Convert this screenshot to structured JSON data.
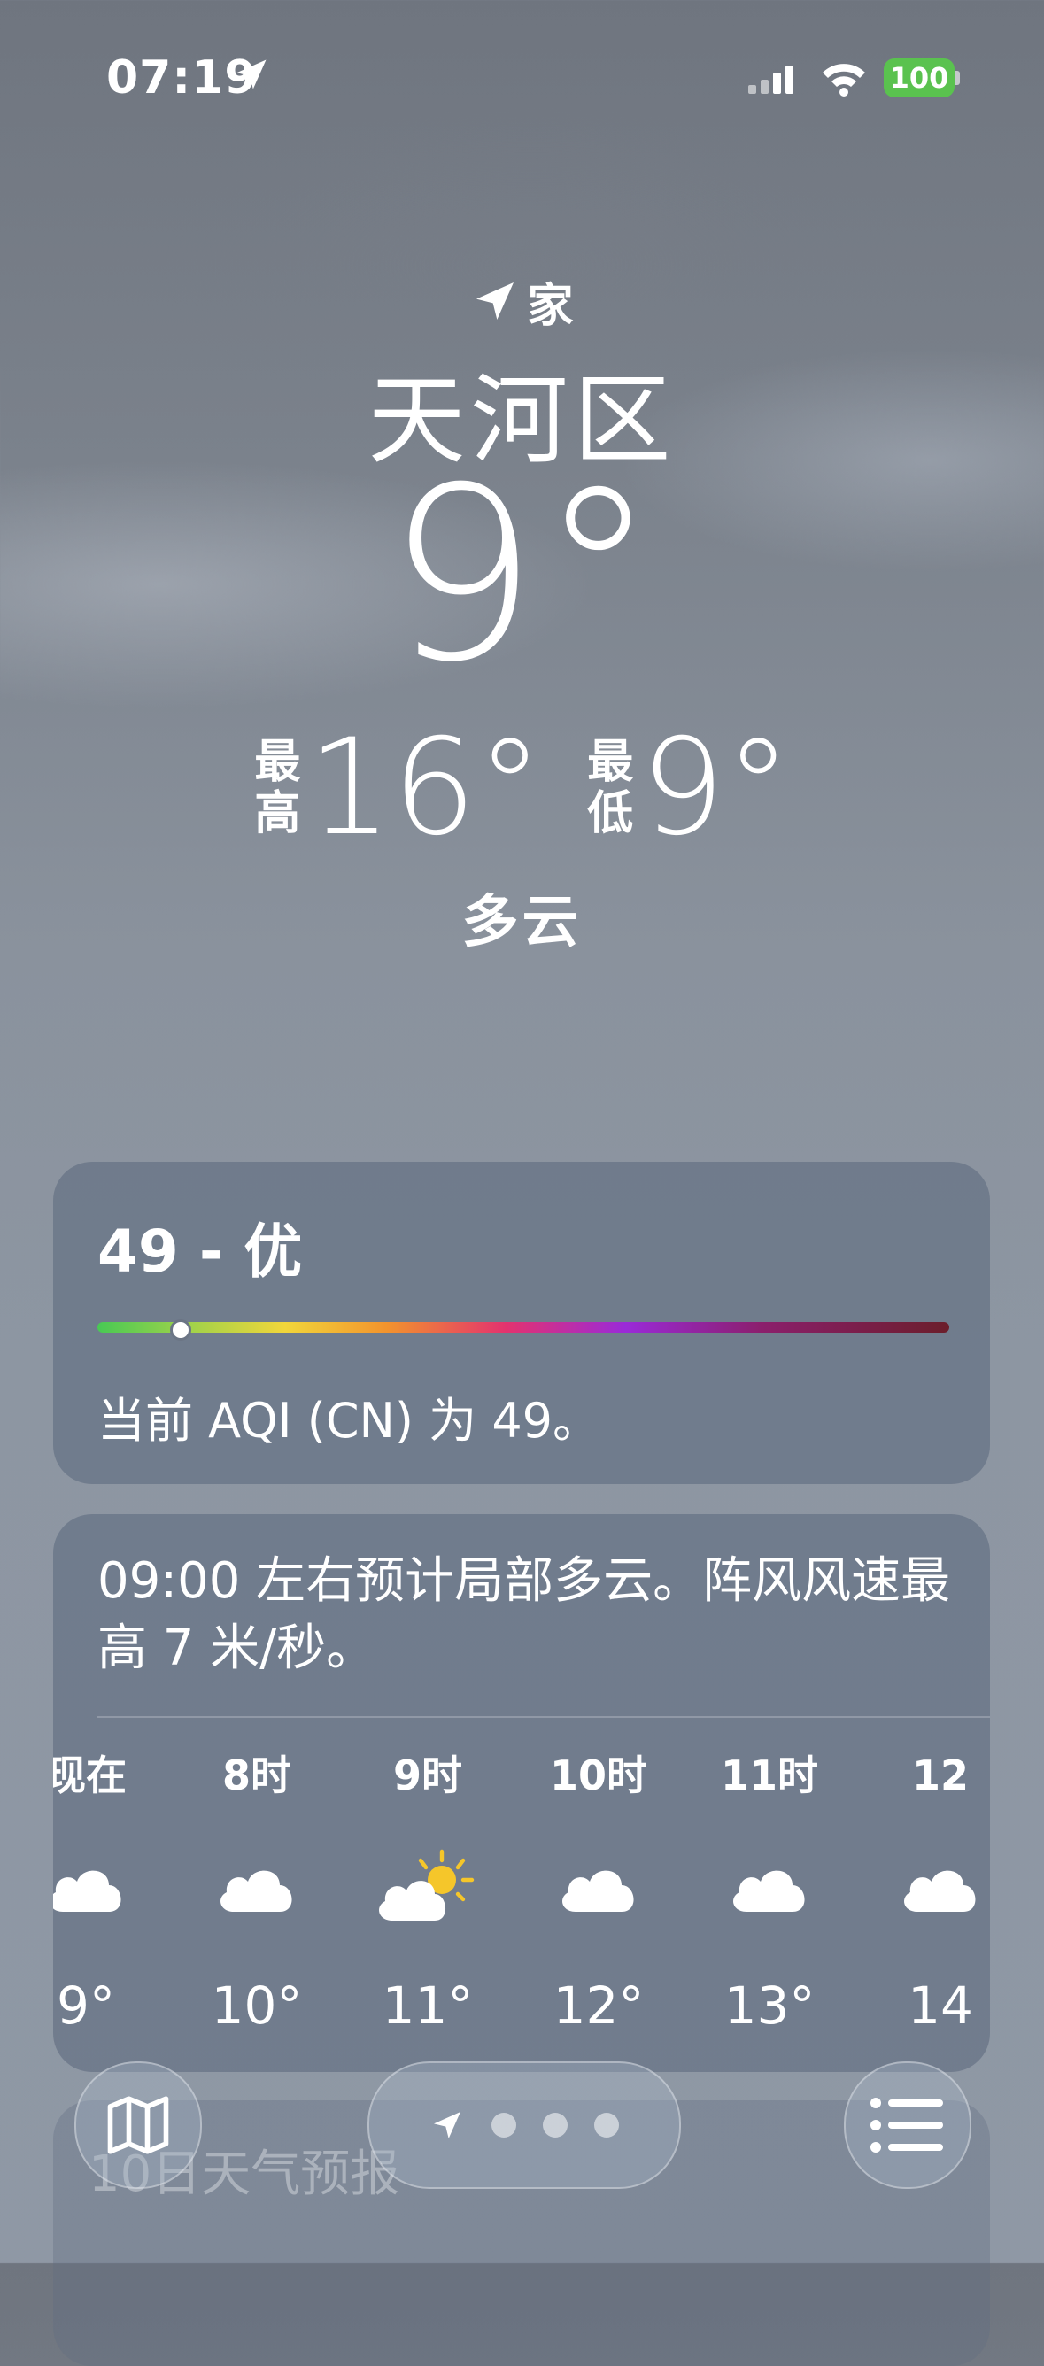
{
  "status_bar": {
    "time": "07:19",
    "battery": "100"
  },
  "header": {
    "location_label": "家",
    "city": "天河区",
    "temperature": "9°",
    "high_label": "最高",
    "high": "16°",
    "low_label": "最低",
    "low": "9°",
    "condition": "多云"
  },
  "aqi": {
    "title": "49 - 优",
    "value": 49,
    "description": "当前 AQI (CN) 为 49。"
  },
  "hourly": {
    "summary": "09:00 左右预计局部多云。阵风风速最高 7 米/秒。",
    "hours": [
      {
        "label": "现在",
        "icon": "cloud-icon",
        "temp": "9°"
      },
      {
        "label": "8时",
        "icon": "cloud-icon",
        "temp": "10°"
      },
      {
        "label": "9时",
        "icon": "partly-sunny-icon",
        "temp": "11°"
      },
      {
        "label": "10时",
        "icon": "cloud-icon",
        "temp": "12°"
      },
      {
        "label": "11时",
        "icon": "cloud-icon",
        "temp": "13°"
      },
      {
        "label": "12",
        "icon": "cloud-icon",
        "temp": "14"
      }
    ]
  },
  "next_card": {
    "label": "10日天气预报"
  },
  "toolbar": {
    "map_icon": "map-icon",
    "list_icon": "list-icon",
    "page_dots": 3
  }
}
